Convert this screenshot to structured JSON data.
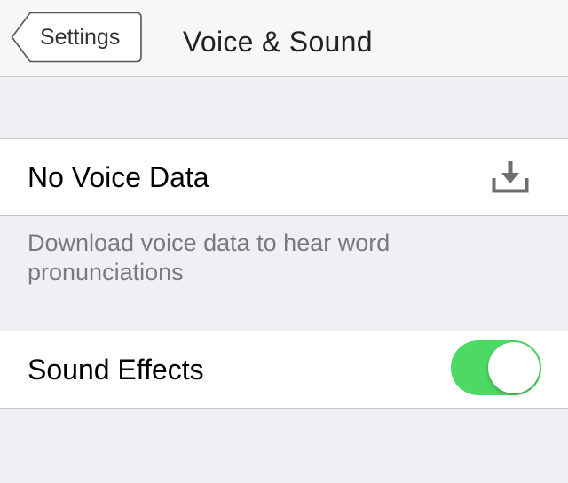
{
  "navbar": {
    "back_label": "Settings",
    "title": "Voice & Sound"
  },
  "voice_cell": {
    "label": "No Voice Data",
    "action_icon": "download-icon"
  },
  "voice_footer": {
    "text": "Download voice data to hear word pronunciations"
  },
  "sound_cell": {
    "label": "Sound Effects",
    "toggle_on": true
  },
  "colors": {
    "toggle_on": "#4cd964",
    "background": "#efeff4",
    "separator": "#c8c7cc"
  }
}
